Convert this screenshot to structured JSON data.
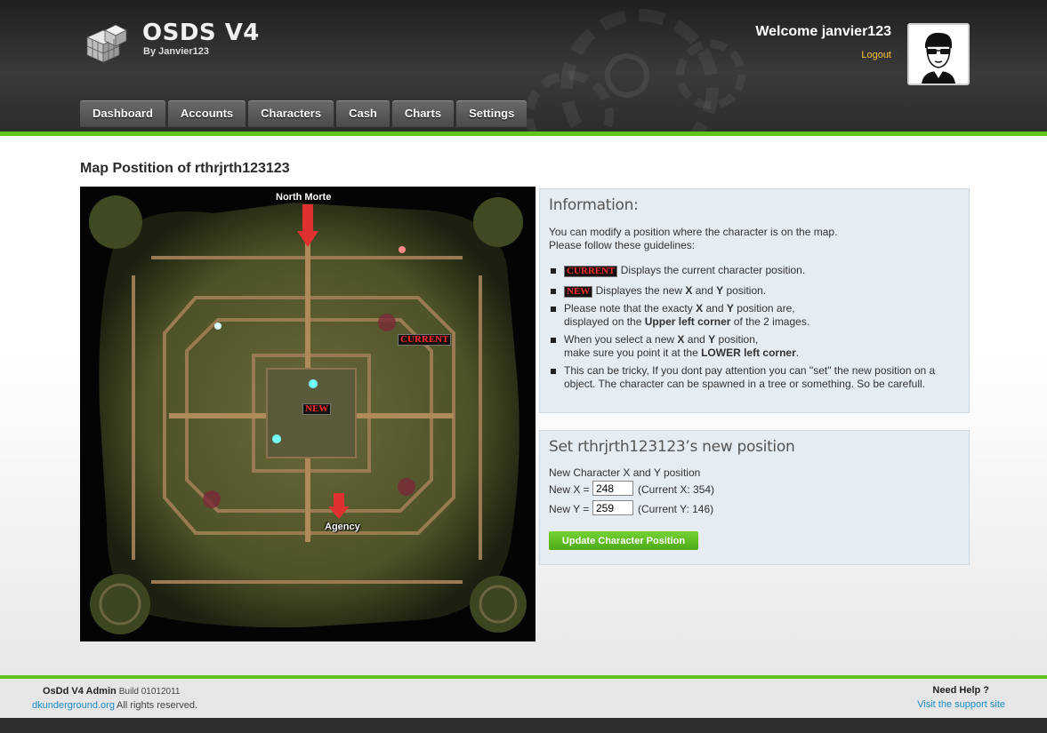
{
  "header": {
    "logo_title": "OSDS V4",
    "logo_subtitle": "By Janvier123",
    "welcome": "Welcome janvier123",
    "logout": "Logout"
  },
  "nav": {
    "items": [
      "Dashboard",
      "Accounts",
      "Characters",
      "Cash",
      "Charts",
      "Settings"
    ]
  },
  "page": {
    "title": "Map Postition of rthrjrth123123"
  },
  "map": {
    "north_label": "North Morte",
    "south_label": "Agency",
    "current_tag": "CURRENT",
    "new_tag": "NEW"
  },
  "info": {
    "heading": "Information:",
    "intro_line1": "You can modify a position where the character is on the map.",
    "intro_line2": "Please follow these guidelines:",
    "g1_tag": "CURRENT",
    "g1_text": "Displays the current character position.",
    "g2_tag": "NEW",
    "g2_pre": "Displayes the new",
    "g2_x": "X",
    "g2_and": "and",
    "g2_y": "Y",
    "g2_post": "position.",
    "g3_pre": "Please note that the exacty",
    "g3_x": "X",
    "g3_and": "and",
    "g3_y": "Y",
    "g3_mid": "position are,",
    "g3_line2_pre": "displayed on the",
    "g3_bold": "Upper left corner",
    "g3_post": "of the 2 images.",
    "g4_pre": "When you select a new",
    "g4_x": "X",
    "g4_and": "and",
    "g4_y": "Y",
    "g4_mid": "position,",
    "g4_line2_pre": "make sure you point it at the",
    "g4_bold": "LOWER left corner",
    "g4_post": ".",
    "g5_text": "This can be tricky, If you dont pay attention you can \"set\" the new position on a object. The character can be spawned in a tree or something. So be carefull."
  },
  "set_position": {
    "heading": "Set rthrjrth123123’s new position",
    "subheading": "New Character X and Y position",
    "x_label": "New X =",
    "x_value": "248",
    "x_current": "(Current X: 354)",
    "y_label": "New Y =",
    "y_value": "259",
    "y_current": "(Current Y: 146)",
    "button": "Update Character Position"
  },
  "footer": {
    "app_name": "OsDd V4 Admin",
    "build": "Build 01012011",
    "site_link": "dkunderground.org",
    "rights": "All rights reserved.",
    "help_title": "Need Help ?",
    "support_link": "Visit the support site"
  },
  "colors": {
    "accent_green": "#5fc41c",
    "link_blue": "#1a8cc7",
    "logout_yellow": "#f7c43a"
  }
}
